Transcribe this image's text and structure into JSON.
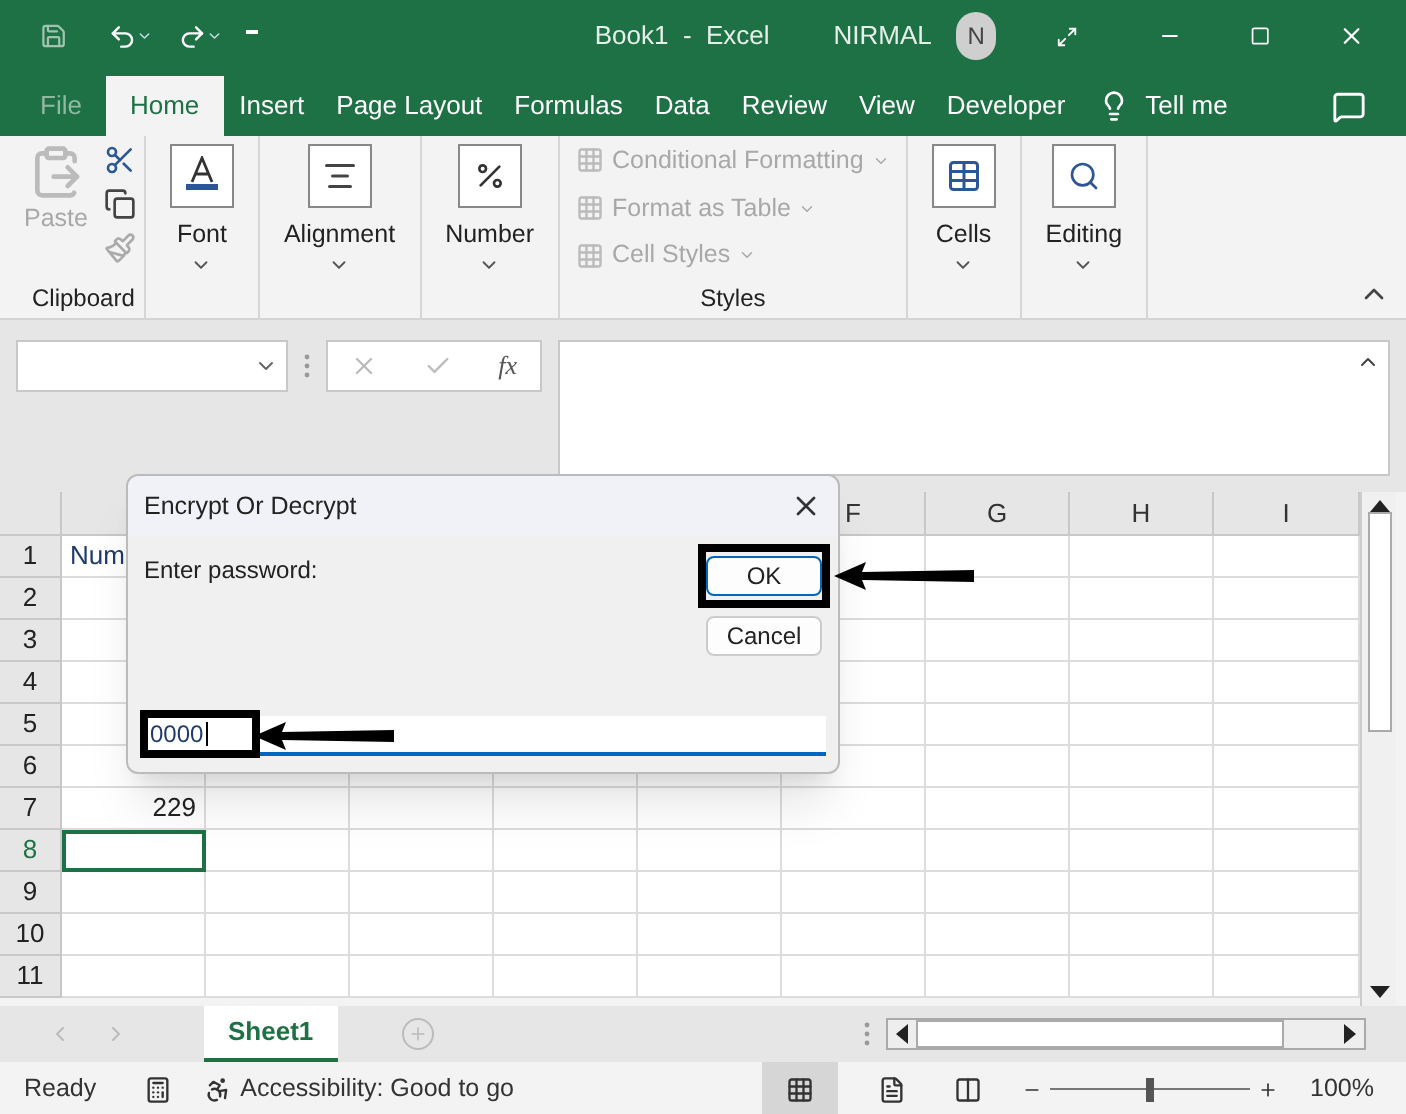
{
  "window": {
    "title": "Book1  -  Excel",
    "user": "NIRMAL",
    "avatar": "N"
  },
  "tabs": [
    {
      "label": "File",
      "selected": false
    },
    {
      "label": "Home",
      "selected": true
    },
    {
      "label": "Insert",
      "selected": false
    },
    {
      "label": "Page Layout",
      "selected": false
    },
    {
      "label": "Formulas",
      "selected": false
    },
    {
      "label": "Data",
      "selected": false
    },
    {
      "label": "Review",
      "selected": false
    },
    {
      "label": "View",
      "selected": false
    },
    {
      "label": "Developer",
      "selected": false
    }
  ],
  "tell_me": "Tell me",
  "ribbon": {
    "paste": {
      "label": "Paste",
      "disabled": true
    },
    "clipboard_label": "Clipboard",
    "groups": [
      {
        "label": "Font",
        "kind": "font"
      },
      {
        "label": "Alignment",
        "kind": "align"
      },
      {
        "label": "Number",
        "kind": "number"
      }
    ],
    "styles": {
      "label": "Styles",
      "items": [
        {
          "label": "Conditional Formatting",
          "disabled": true
        },
        {
          "label": "Format as Table",
          "disabled": true
        },
        {
          "label": "Cell Styles",
          "disabled": true
        }
      ]
    },
    "groups2": [
      {
        "label": "Cells",
        "kind": "cells"
      },
      {
        "label": "Editing",
        "kind": "editing"
      }
    ]
  },
  "formula_bar": {
    "fx": "fx"
  },
  "sheet": {
    "columns": [
      {
        "label": "F"
      },
      {
        "label": "G"
      },
      {
        "label": "H"
      },
      {
        "label": "I"
      }
    ],
    "rows": [
      {
        "label": "1",
        "cells": [
          "Num"
        ],
        "selected": false
      },
      {
        "label": "2",
        "cells": [],
        "selected": false
      },
      {
        "label": "3",
        "cells": [],
        "selected": false
      },
      {
        "label": "4",
        "cells": [],
        "selected": false
      },
      {
        "label": "5",
        "cells": [],
        "selected": false
      },
      {
        "label": "6",
        "cells": [],
        "selected": false
      },
      {
        "label": "7",
        "cells": [
          "229"
        ],
        "selected": false
      },
      {
        "label": "8",
        "cells": [],
        "selected": true
      },
      {
        "label": "9",
        "cells": [],
        "selected": false
      },
      {
        "label": "10",
        "cells": [],
        "selected": false
      },
      {
        "label": "11",
        "cells": [],
        "selected": false
      }
    ]
  },
  "sheet_tabs": [
    {
      "label": "Sheet1",
      "selected": true
    }
  ],
  "dialog": {
    "title": "Encrypt Or Decrypt",
    "prompt": "Enter password:",
    "ok": "OK",
    "cancel": "Cancel",
    "value": "0000"
  },
  "status_bar": {
    "ready": "Ready",
    "accessibility": "Accessibility: Good to go",
    "zoom": {
      "level": 0.5,
      "reading": "100%"
    }
  }
}
